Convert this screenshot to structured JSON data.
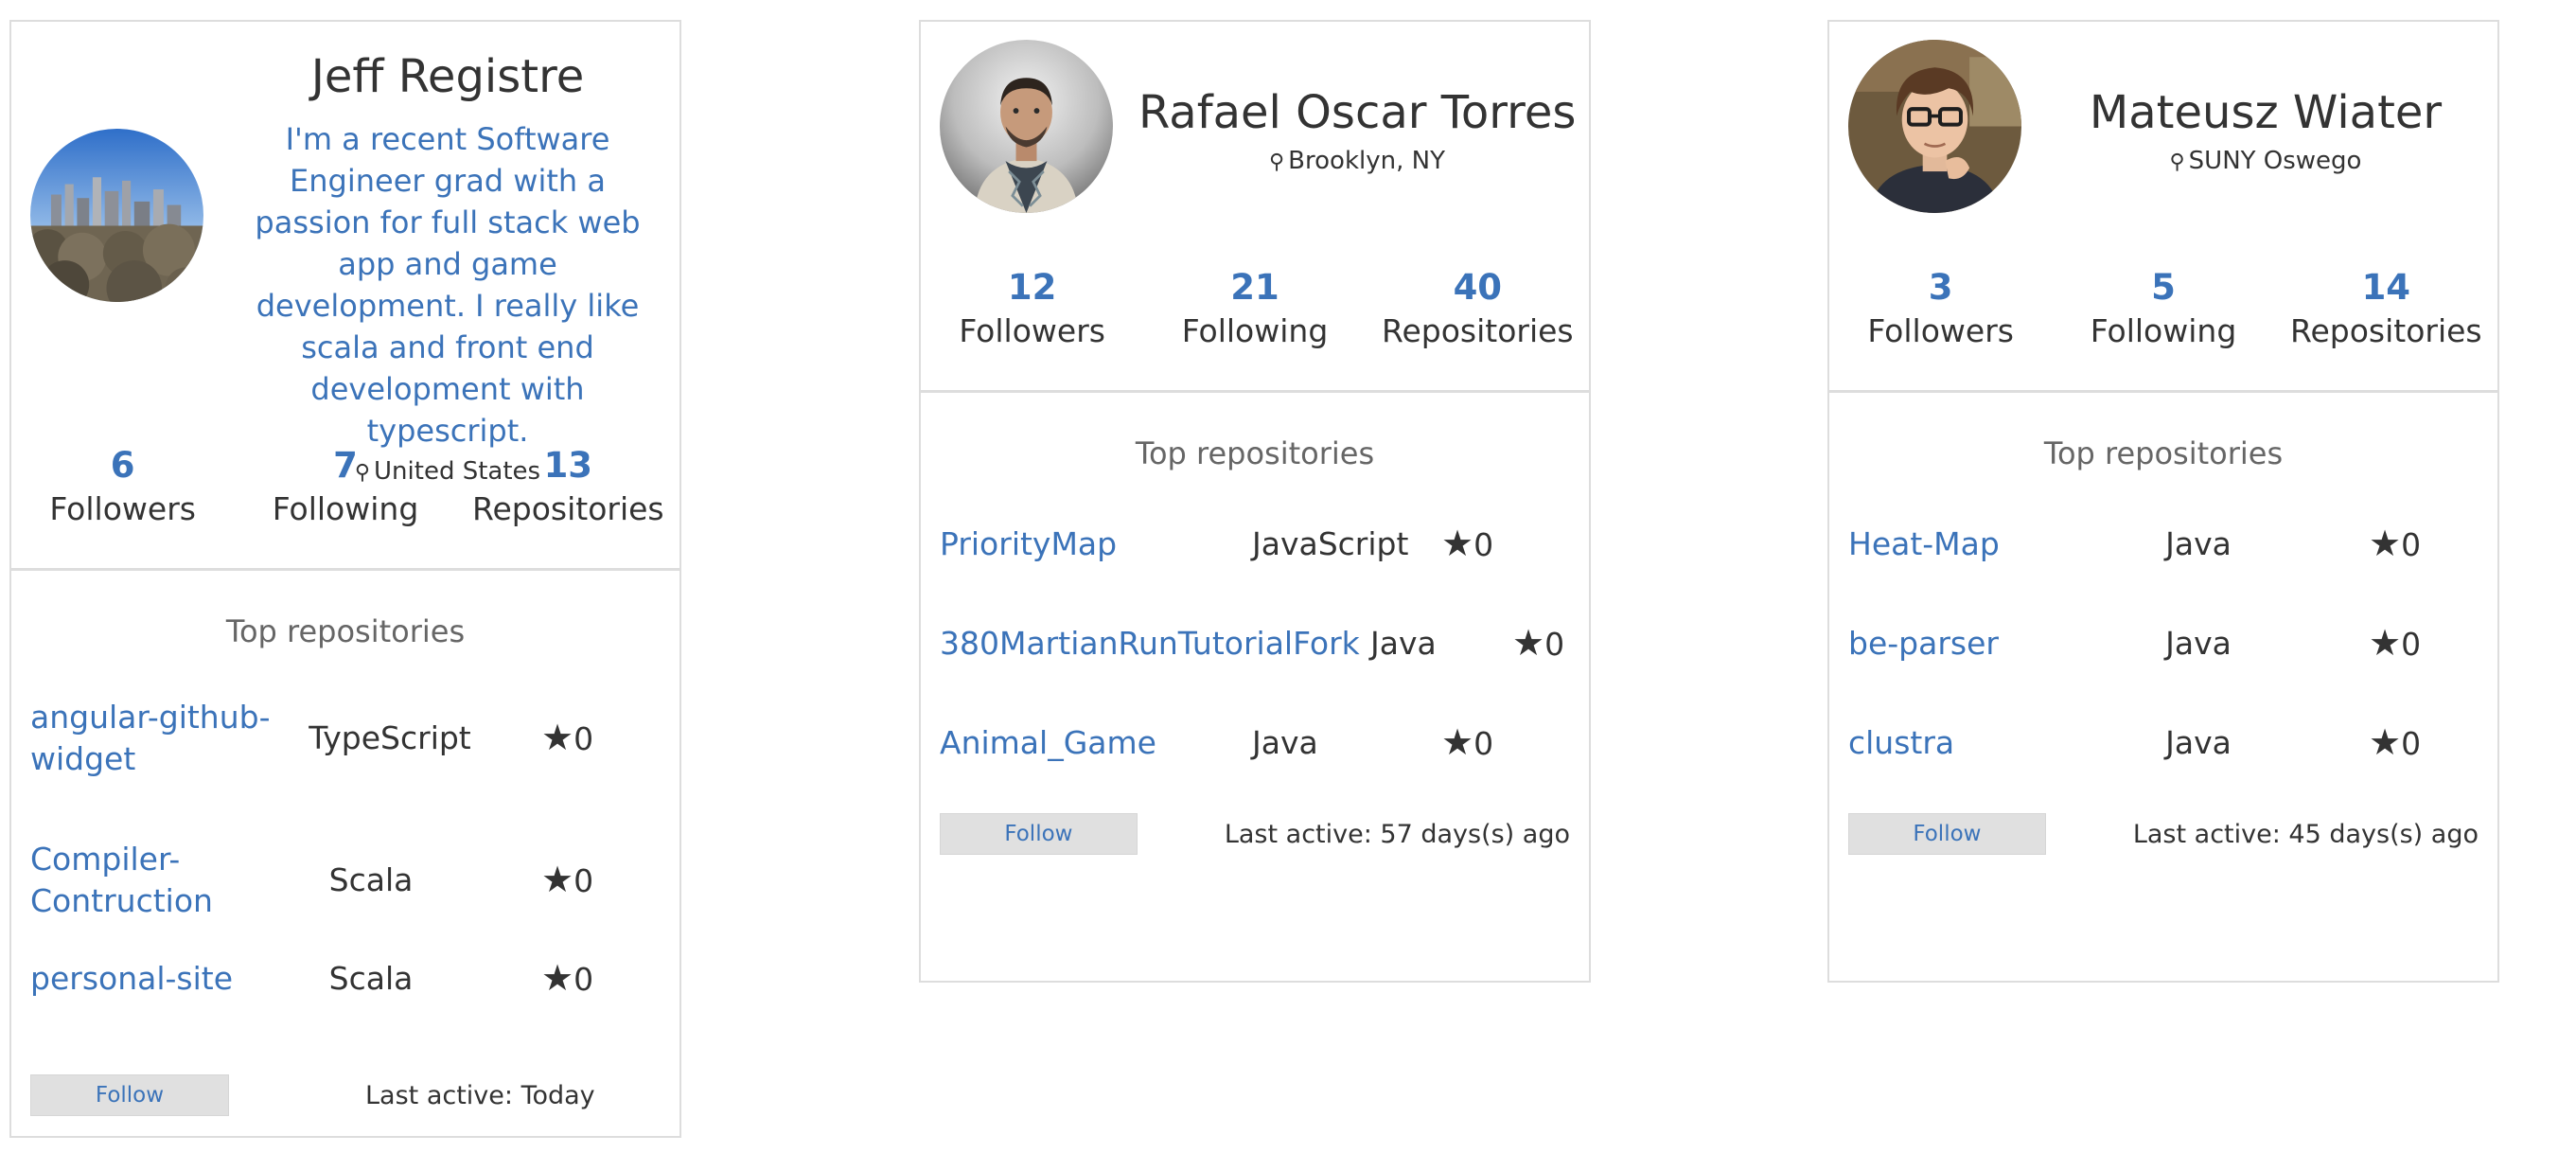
{
  "cards": [
    {
      "name": "Jeff Registre",
      "bio": "I'm a recent Software Engineer grad with a passion for full stack web app and game development. I really like scala and front end development with typescript.",
      "location": "United States",
      "stats": {
        "followers_count": "6",
        "followers_label": "Followers",
        "following_count": "7",
        "following_label": "Following",
        "repos_count": "13",
        "repos_label": "Repositories"
      },
      "top_repos_title": "Top repositories",
      "repos": [
        {
          "name": "angular-github-widget",
          "language": "TypeScript",
          "stars": "0"
        },
        {
          "name": "Compiler-Contruction",
          "language": "Scala",
          "stars": "0"
        },
        {
          "name": "personal-site",
          "language": "Scala",
          "stars": "0"
        }
      ],
      "follow_label": "Follow",
      "last_active": "Last active: Today"
    },
    {
      "name": "Rafael Oscar Torres",
      "location": "Brooklyn, NY",
      "stats": {
        "followers_count": "12",
        "followers_label": "Followers",
        "following_count": "21",
        "following_label": "Following",
        "repos_count": "40",
        "repos_label": "Repositories"
      },
      "top_repos_title": "Top repositories",
      "repos": [
        {
          "name": "PriorityMap",
          "language": "JavaScript",
          "stars": "0"
        },
        {
          "name": "380MartianRunTutorialFork",
          "language": "Java",
          "stars": "0"
        },
        {
          "name": "Animal_Game",
          "language": "Java",
          "stars": "0"
        }
      ],
      "follow_label": "Follow",
      "last_active": "Last active: 57 days(s) ago"
    },
    {
      "name": "Mateusz Wiater",
      "location": "SUNY Oswego",
      "stats": {
        "followers_count": "3",
        "followers_label": "Followers",
        "following_count": "5",
        "following_label": "Following",
        "repos_count": "14",
        "repos_label": "Repositories"
      },
      "top_repos_title": "Top repositories",
      "repos": [
        {
          "name": "Heat-Map",
          "language": "Java",
          "stars": "0"
        },
        {
          "name": "be-parser",
          "language": "Java",
          "stars": "0"
        },
        {
          "name": "clustra",
          "language": "Java",
          "stars": "0"
        }
      ],
      "follow_label": "Follow",
      "last_active": "Last active: 45 days(s) ago"
    }
  ],
  "icons": {
    "location": "location-pin-icon",
    "star": "star-icon"
  },
  "colors": {
    "link": "#3b73b9",
    "text": "#333333",
    "border": "#dddddd",
    "button_bg": "#e0e0e0"
  }
}
